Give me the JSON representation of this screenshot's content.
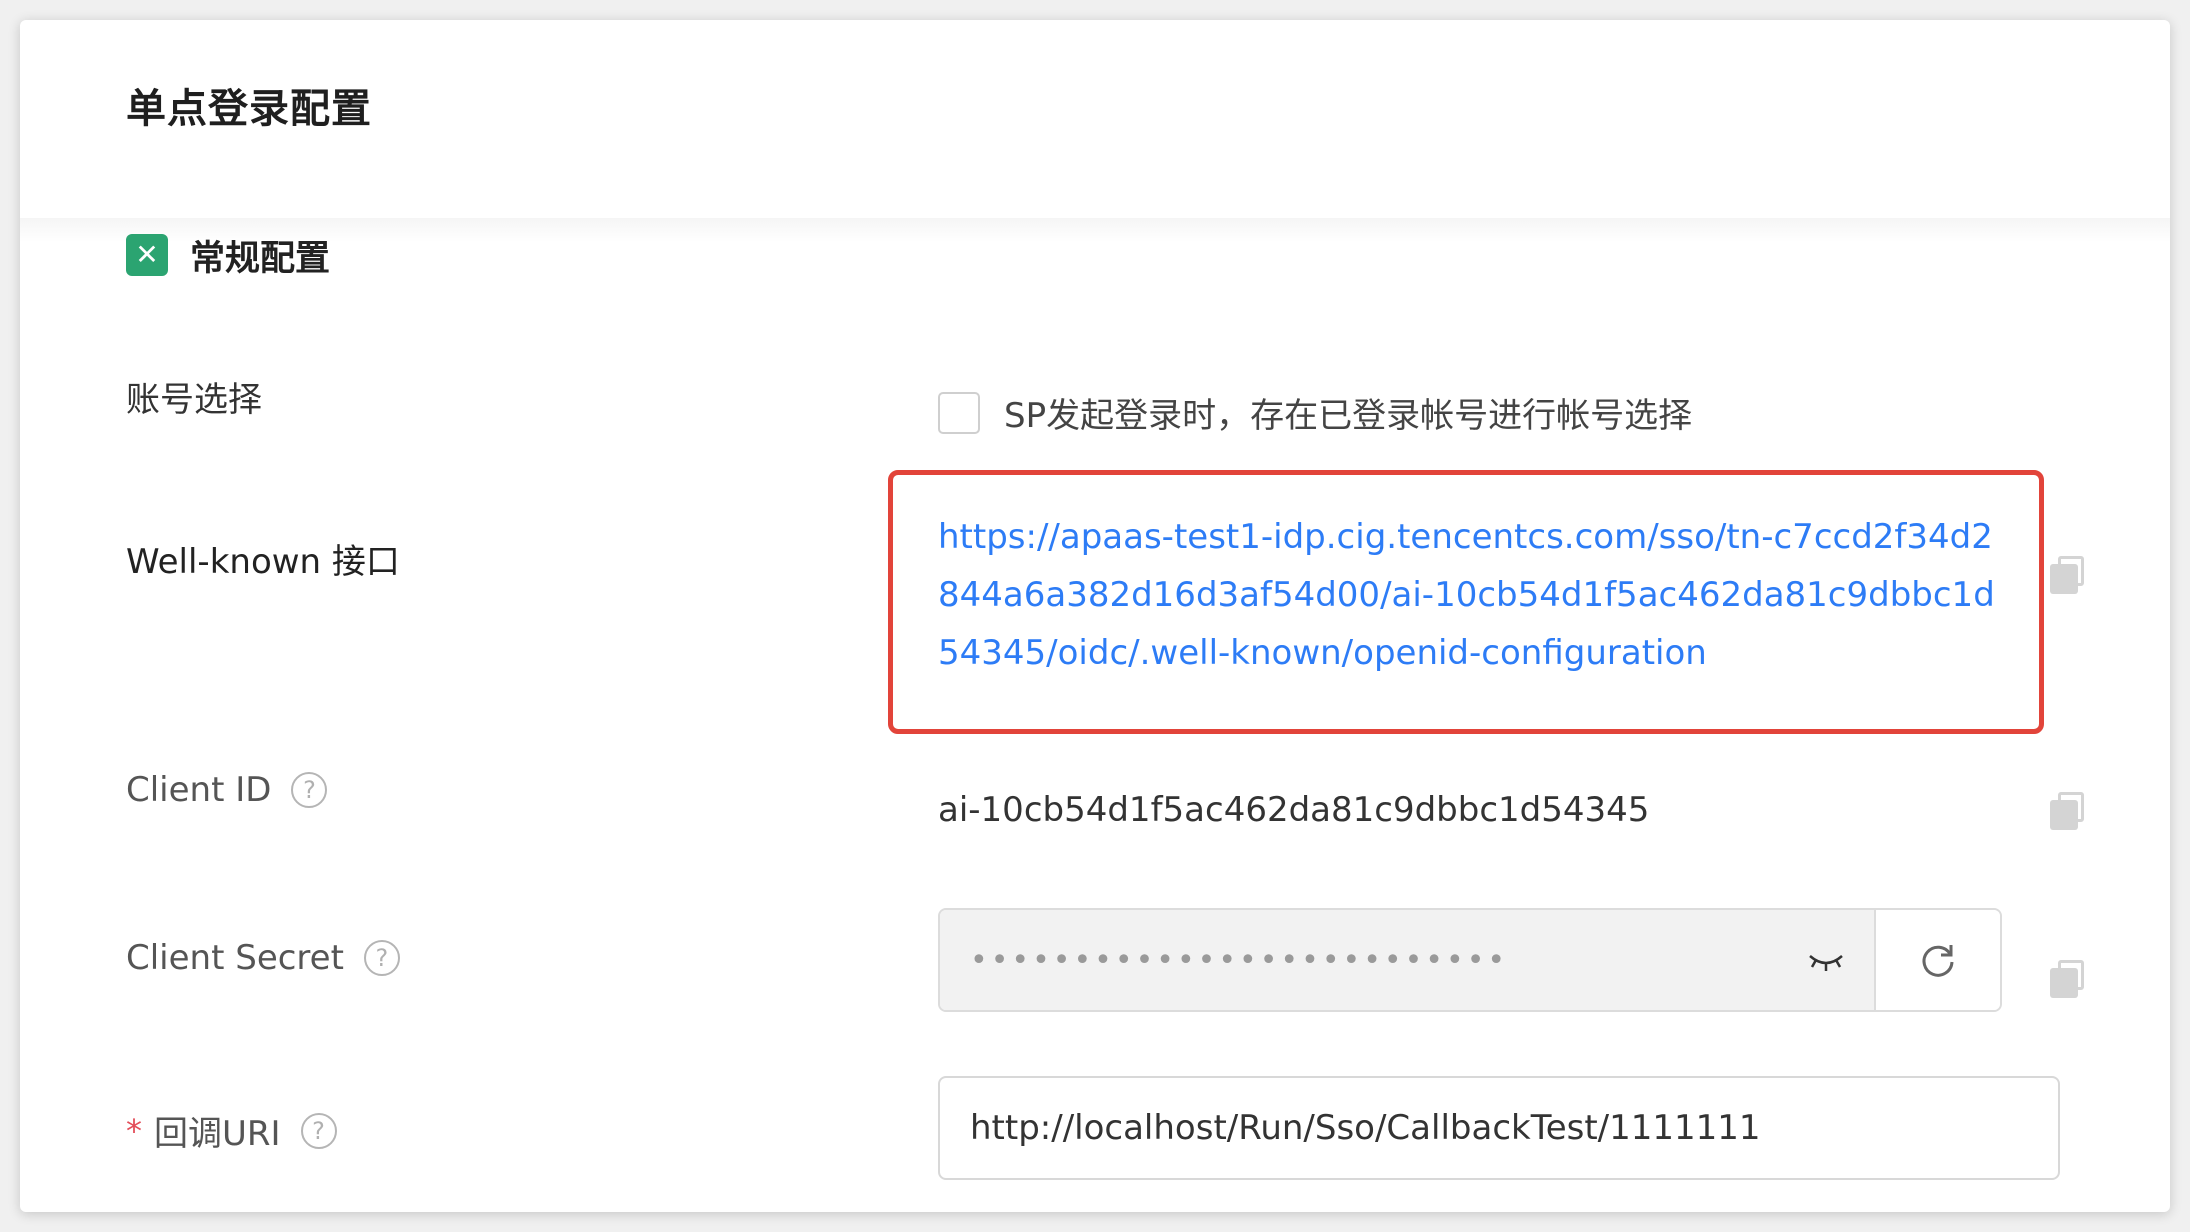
{
  "page": {
    "title": "单点登录配置"
  },
  "section": {
    "title": "常规配置",
    "icon": "green-square-icon"
  },
  "fields": {
    "account_select": {
      "label": "账号选择",
      "checkbox_text": "SP发起登录时，存在已登录帐号进行帐号选择",
      "checked": false
    },
    "wellknown": {
      "label": "Well-known 接口",
      "url": "https://apaas-test1-idp.cig.tencentcs.com/sso/tn-c7ccd2f34d2844a6a382d16d3af54d00/ai-10cb54d1f5ac462da81c9dbbc1d54345/oidc/.well-known/openid-configuration"
    },
    "client_id": {
      "label": "Client ID",
      "value": "ai-10cb54d1f5ac462da81c9dbbc1d54345"
    },
    "client_secret": {
      "label": "Client Secret",
      "masked_value": "••••••••••••••••••••••••••"
    },
    "callback_uri": {
      "required_mark": "*",
      "label": "回调URI",
      "value": "http://localhost/Run/Sso/CallbackTest/1111111"
    }
  },
  "colors": {
    "link": "#2d7cf6",
    "highlight_border": "#e2443a",
    "section_icon": "#2ba471",
    "required": "#e34d59"
  }
}
